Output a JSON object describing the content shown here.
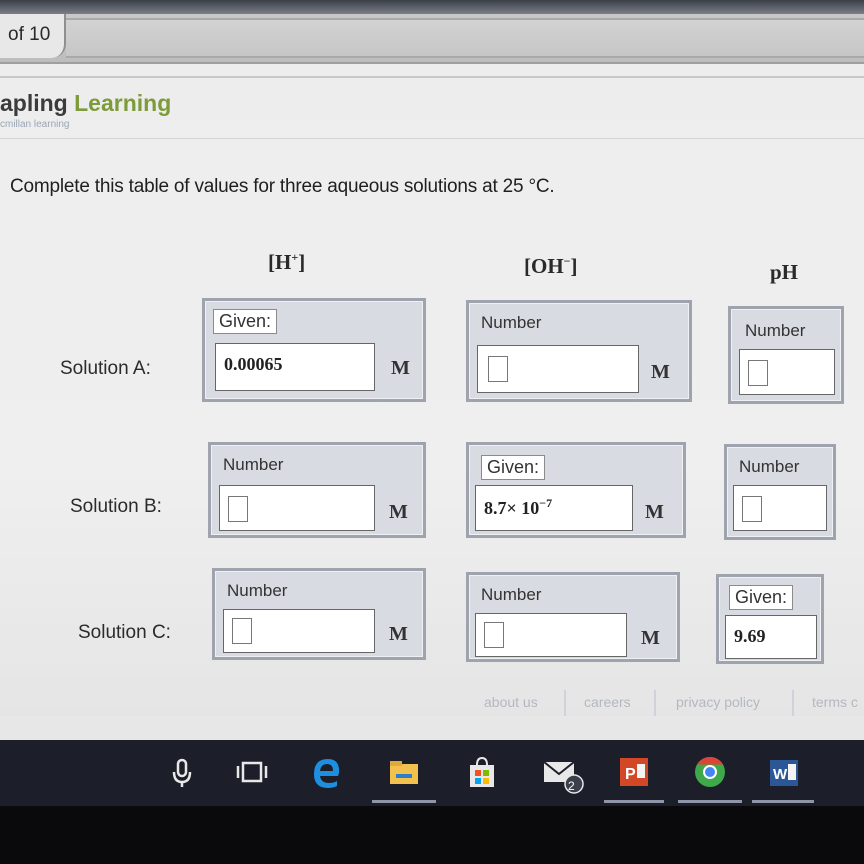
{
  "browser": {
    "page_tab_label": "of 10"
  },
  "brand": {
    "name_prefix": "apling",
    "name_suffix": "Learning",
    "tagline": "cmillan learning"
  },
  "question": "Complete this table of values for three aqueous solutions at 25 °C.",
  "columns": {
    "h_plus": {
      "base": "H",
      "sup": "+"
    },
    "oh_minus": {
      "base": "OH",
      "sup": "−"
    },
    "ph": "pH"
  },
  "rows": [
    {
      "label": "Solution A:",
      "h_tag": "Given:",
      "h_value": "0.00065",
      "oh_tag": "Number",
      "oh_value": "",
      "ph_tag": "Number",
      "ph_value": ""
    },
    {
      "label": "Solution B:",
      "h_tag": "Number",
      "h_value": "",
      "oh_tag": "Given:",
      "oh_value_base": "8.7× 10",
      "oh_value_exp": "−7",
      "ph_tag": "Number",
      "ph_value": ""
    },
    {
      "label": "Solution C:",
      "h_tag": "Number",
      "h_value": "",
      "oh_tag": "Number",
      "oh_value": "",
      "ph_tag": "Given:",
      "ph_value": "9.69"
    }
  ],
  "unit": "M",
  "footer": [
    "about us",
    "careers",
    "privacy policy",
    "terms c"
  ],
  "taskbar": {
    "icons": [
      "microphone-icon",
      "task-view-icon",
      "edge-icon",
      "file-explorer-icon",
      "store-icon",
      "mail-icon",
      "powerpoint-icon",
      "chrome-icon",
      "word-icon"
    ],
    "mail_badge": "2",
    "colors": {
      "edge": "#1e8fe0",
      "explorer": "#f2c14e",
      "powerpoint": "#d24726",
      "chrome_green": "#3ea84a",
      "word": "#2b5797"
    }
  }
}
